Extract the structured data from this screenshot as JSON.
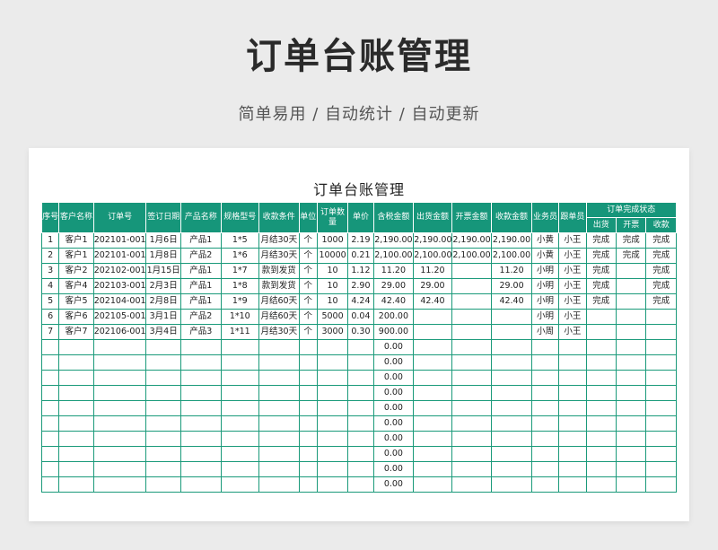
{
  "hero": {
    "title": "订单台账管理",
    "subtitle": "简单易用 / 自动统计 / 自动更新"
  },
  "sheet": {
    "title": "订单台账管理"
  },
  "table": {
    "headers": [
      "序号",
      "客户名称",
      "订单号",
      "签订日期",
      "产品名称",
      "规格型号",
      "收款条件",
      "单位",
      "订单数量",
      "单价",
      "含税金额",
      "出货金额",
      "开票金额",
      "收款金额",
      "业务员",
      "跟单员"
    ],
    "status_group": "订单完成状态",
    "status_headers": [
      "出货",
      "开票",
      "收款"
    ],
    "rows": [
      [
        "1",
        "客户1",
        "202101-001",
        "1月6日",
        "产品1",
        "1*5",
        "月结30天",
        "个",
        "1000",
        "2.19",
        "2,190.00",
        "2,190.00",
        "2,190.00",
        "2,190.00",
        "小黄",
        "小王",
        "完成",
        "完成",
        "完成"
      ],
      [
        "2",
        "客户1",
        "202101-001",
        "1月8日",
        "产品2",
        "1*6",
        "月结30天",
        "个",
        "10000",
        "0.21",
        "2,100.00",
        "2,100.00",
        "2,100.00",
        "2,100.00",
        "小黄",
        "小王",
        "完成",
        "完成",
        "完成"
      ],
      [
        "3",
        "客户2",
        "202102-001",
        "1月15日",
        "产品1",
        "1*7",
        "款到发货",
        "个",
        "10",
        "1.12",
        "11.20",
        "11.20",
        "",
        "11.20",
        "小明",
        "小王",
        "完成",
        "",
        "完成"
      ],
      [
        "4",
        "客户4",
        "202103-001",
        "2月3日",
        "产品1",
        "1*8",
        "款到发货",
        "个",
        "10",
        "2.90",
        "29.00",
        "29.00",
        "",
        "29.00",
        "小明",
        "小王",
        "完成",
        "",
        "完成"
      ],
      [
        "5",
        "客户5",
        "202104-001",
        "2月8日",
        "产品1",
        "1*9",
        "月结60天",
        "个",
        "10",
        "4.24",
        "42.40",
        "42.40",
        "",
        "42.40",
        "小明",
        "小王",
        "完成",
        "",
        "完成"
      ],
      [
        "6",
        "客户6",
        "202105-001",
        "3月1日",
        "产品2",
        "1*10",
        "月结60天",
        "个",
        "5000",
        "0.04",
        "200.00",
        "",
        "",
        "",
        "小明",
        "小王",
        "",
        "",
        ""
      ],
      [
        "7",
        "客户7",
        "202106-001",
        "3月4日",
        "产品3",
        "1*11",
        "月结30天",
        "个",
        "3000",
        "0.30",
        "900.00",
        "",
        "",
        "",
        "小周",
        "小王",
        "",
        "",
        ""
      ],
      [
        "",
        "",
        "",
        "",
        "",
        "",
        "",
        "",
        "",
        "",
        "0.00",
        "",
        "",
        "",
        "",
        "",
        "",
        "",
        ""
      ],
      [
        "",
        "",
        "",
        "",
        "",
        "",
        "",
        "",
        "",
        "",
        "0.00",
        "",
        "",
        "",
        "",
        "",
        "",
        "",
        ""
      ],
      [
        "",
        "",
        "",
        "",
        "",
        "",
        "",
        "",
        "",
        "",
        "0.00",
        "",
        "",
        "",
        "",
        "",
        "",
        "",
        ""
      ],
      [
        "",
        "",
        "",
        "",
        "",
        "",
        "",
        "",
        "",
        "",
        "0.00",
        "",
        "",
        "",
        "",
        "",
        "",
        "",
        ""
      ],
      [
        "",
        "",
        "",
        "",
        "",
        "",
        "",
        "",
        "",
        "",
        "0.00",
        "",
        "",
        "",
        "",
        "",
        "",
        "",
        ""
      ],
      [
        "",
        "",
        "",
        "",
        "",
        "",
        "",
        "",
        "",
        "",
        "0.00",
        "",
        "",
        "",
        "",
        "",
        "",
        "",
        ""
      ],
      [
        "",
        "",
        "",
        "",
        "",
        "",
        "",
        "",
        "",
        "",
        "0.00",
        "",
        "",
        "",
        "",
        "",
        "",
        "",
        ""
      ],
      [
        "",
        "",
        "",
        "",
        "",
        "",
        "",
        "",
        "",
        "",
        "0.00",
        "",
        "",
        "",
        "",
        "",
        "",
        "",
        ""
      ],
      [
        "",
        "",
        "",
        "",
        "",
        "",
        "",
        "",
        "",
        "",
        "0.00",
        "",
        "",
        "",
        "",
        "",
        "",
        "",
        ""
      ],
      [
        "",
        "",
        "",
        "",
        "",
        "",
        "",
        "",
        "",
        "",
        "0.00",
        "",
        "",
        "",
        "",
        "",
        "",
        "",
        ""
      ]
    ]
  },
  "colors": {
    "header_bg": "#16967a",
    "grid": "#1a9a7a"
  }
}
